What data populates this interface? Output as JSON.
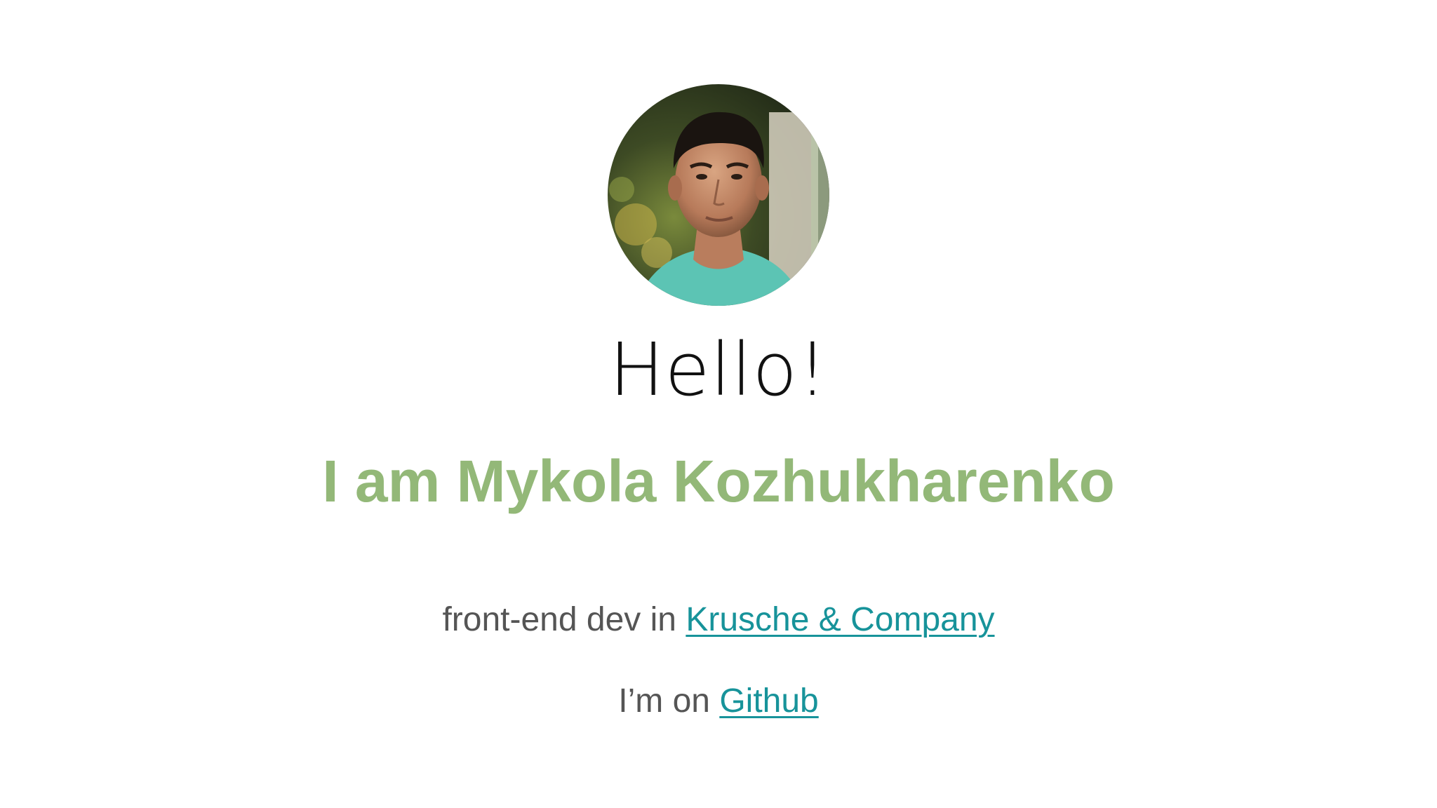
{
  "slide": {
    "greeting": "Hello!",
    "name": "I am Mykola Kozhukharenko",
    "role_prefix": "front-end dev in ",
    "company_link": "Krusche & Company",
    "github_prefix": "I’m on ",
    "github_link": "Github"
  },
  "colors": {
    "name": "#93b878",
    "link": "#17939a",
    "body_text": "#555555",
    "greeting": "#111111"
  }
}
